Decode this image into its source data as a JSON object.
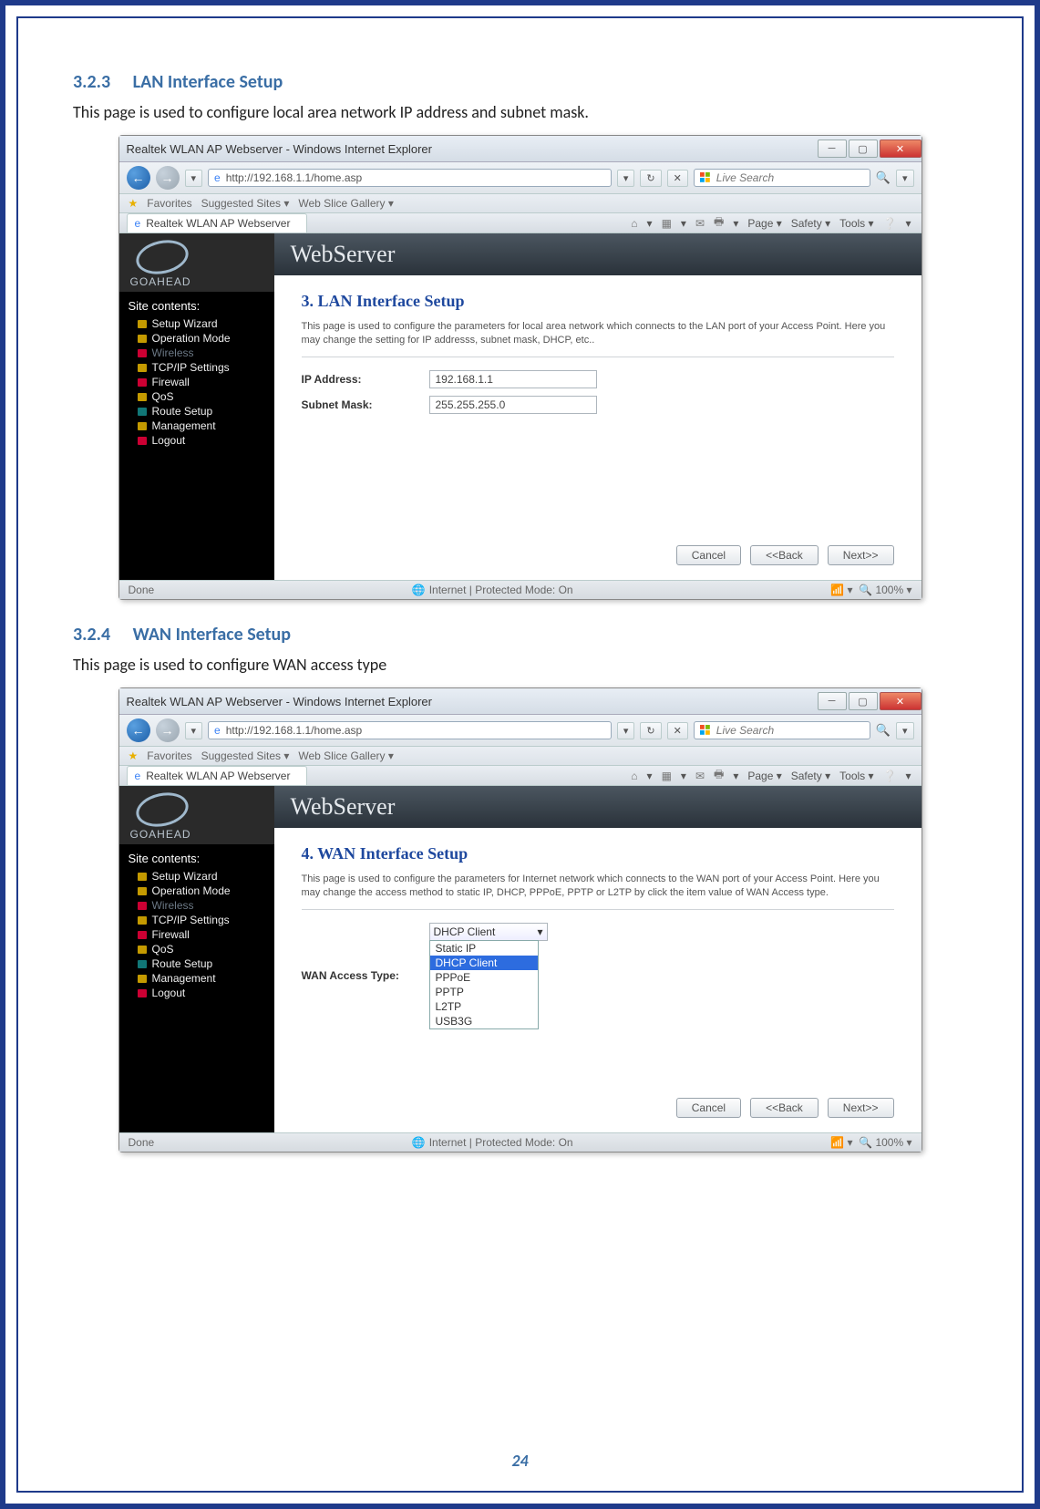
{
  "page_number": "24",
  "sections": [
    {
      "number": "3.2.3",
      "title": "LAN Interface Setup",
      "desc": "This page is used to configure local area network IP address and subnet mask."
    },
    {
      "number": "3.2.4",
      "title": "WAN Interface Setup",
      "desc": "This page is used to configure WAN access type"
    }
  ],
  "ie": {
    "window_title": "Realtek WLAN AP Webserver - Windows Internet Explorer",
    "url": "http://192.168.1.1/home.asp",
    "search_placeholder": "Live Search",
    "fav_label": "Favorites",
    "fav_links": [
      "Suggested Sites ▾",
      "Web Slice Gallery ▾"
    ],
    "tab_label": "Realtek WLAN AP Webserver",
    "cmd": {
      "page": "Page ▾",
      "safety": "Safety ▾",
      "tools": "Tools ▾"
    },
    "status_left": "Done",
    "status_mid": "Internet | Protected Mode: On",
    "zoom": "100%"
  },
  "webserver": {
    "brand": "GOAHEAD",
    "header": "WebServer",
    "tree_head": "Site contents:",
    "tree": [
      {
        "label": "Setup Wizard",
        "class": ""
      },
      {
        "label": "Operation Mode",
        "class": ""
      },
      {
        "label": "Wireless",
        "class": "dim"
      },
      {
        "label": "TCP/IP Settings",
        "class": ""
      },
      {
        "label": "Firewall",
        "class": ""
      },
      {
        "label": "QoS",
        "class": ""
      },
      {
        "label": "Route Setup",
        "class": ""
      },
      {
        "label": "Management",
        "class": ""
      },
      {
        "label": "Logout",
        "class": ""
      }
    ]
  },
  "lan": {
    "title": "3. LAN Interface Setup",
    "desc": "This page is used to configure the parameters for local area network which connects to the LAN port of your Access Point. Here you may change the setting for IP addresss, subnet mask, DHCP, etc..",
    "fields": {
      "ip_label": "IP Address:",
      "ip_value": "192.168.1.1",
      "mask_label": "Subnet Mask:",
      "mask_value": "255.255.255.0"
    }
  },
  "wan": {
    "title": "4. WAN Interface Setup",
    "desc": "This page is used to configure the parameters for Internet network which connects to the WAN port of your Access Point. Here you may change the access method to static IP, DHCP, PPPoE, PPTP or L2TP by click the item value of WAN Access type.",
    "access_label": "WAN Access Type:",
    "selected": "DHCP Client",
    "options": [
      "Static IP",
      "DHCP Client",
      "PPPoE",
      "PPTP",
      "L2TP",
      "USB3G"
    ]
  },
  "buttons": {
    "cancel": "Cancel",
    "back": "<<Back",
    "next": "Next>>"
  }
}
